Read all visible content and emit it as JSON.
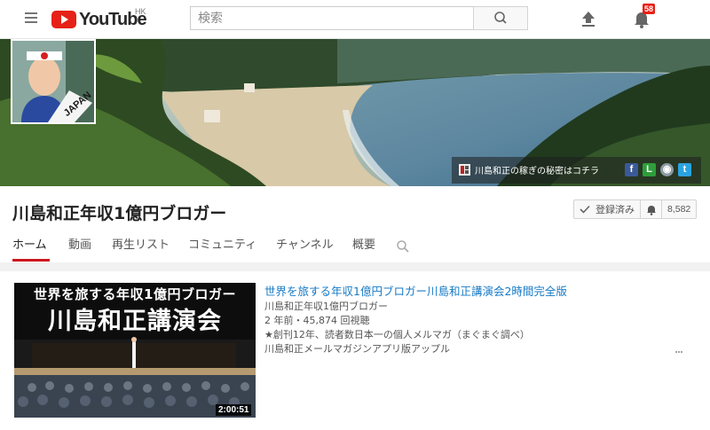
{
  "masthead": {
    "logo_text": "YouTube",
    "region": "HK",
    "search_placeholder": "検索",
    "notification_count": "58",
    "icons": [
      "menu-icon",
      "search-icon",
      "upload-icon",
      "bell-icon"
    ]
  },
  "banner": {
    "avatar_text": "JAPAN",
    "link_text": "川島和正の稼ぎの秘密はコチラ",
    "social_links": [
      "facebook",
      "line",
      "website",
      "twitter"
    ]
  },
  "channel": {
    "title": "川島和正年収1億円ブロガー",
    "subscribe_label": "登録済み",
    "subscriber_count": "8,582"
  },
  "tabs": [
    {
      "label": "ホーム",
      "active": true
    },
    {
      "label": "動画",
      "active": false
    },
    {
      "label": "再生リスト",
      "active": false
    },
    {
      "label": "コミュニティ",
      "active": false
    },
    {
      "label": "チャンネル",
      "active": false
    },
    {
      "label": "概要",
      "active": false
    }
  ],
  "video": {
    "thumb_subtitle": "世界を旅する年収1億円ブロガー",
    "thumb_title": "川島和正講演会",
    "duration": "2:00:51",
    "title": "世界を旅する年収1億円ブロガー川島和正講演会2時間完全版",
    "channel": "川島和正年収1億円ブロガー",
    "meta": "2 年前・45,874 回視聴",
    "description_line1": "★創刊12年、読者数日本一の個人メルマガ（まぐまぐ調べ）",
    "description_line2": "川島和正メールマガジンアプリ版アップル"
  },
  "colors": {
    "brand_red": "#e62117",
    "link_blue": "#167ac6",
    "tab_underline": "#cc181e"
  }
}
